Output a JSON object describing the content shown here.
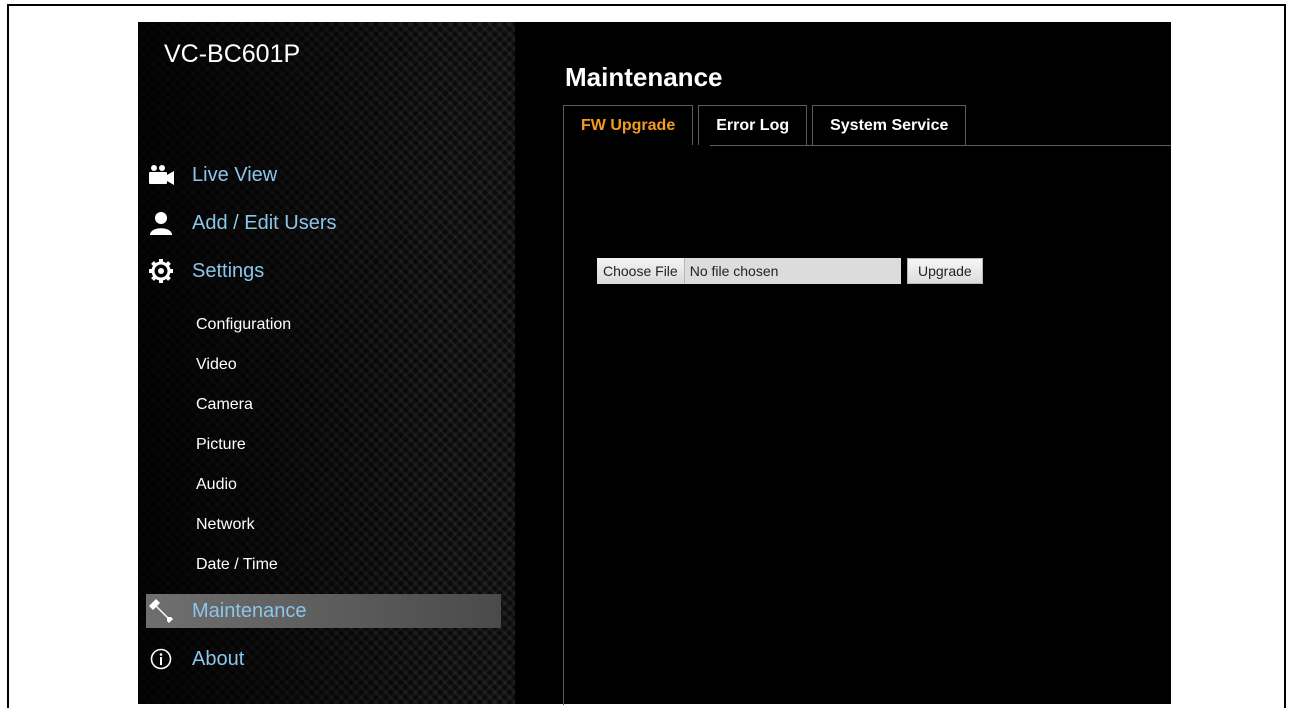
{
  "sidebar": {
    "brand": "VC-BC601P",
    "nav": [
      {
        "label": "Live View",
        "icon": "video-camera-icon"
      },
      {
        "label": "Add / Edit Users",
        "icon": "user-icon"
      },
      {
        "label": "Settings",
        "icon": "gear-icon"
      },
      {
        "label": "Maintenance",
        "icon": "wrench-icon",
        "active": true
      },
      {
        "label": "About",
        "icon": "info-icon"
      }
    ],
    "settings_sub": [
      "Configuration",
      "Video",
      "Camera",
      "Picture",
      "Audio",
      "Network",
      "Date / Time"
    ]
  },
  "main": {
    "title": "Maintenance",
    "tabs": [
      {
        "label": "FW Upgrade",
        "active": true
      },
      {
        "label": "Error Log"
      },
      {
        "label": "System Service"
      }
    ],
    "file_input": {
      "button_label": "Choose File",
      "status": "No file chosen"
    },
    "upgrade_label": "Upgrade"
  },
  "colors": {
    "accent_tab": "#f39a20",
    "nav_link": "#8cc6ea",
    "active_row": "#6f6f6f"
  }
}
